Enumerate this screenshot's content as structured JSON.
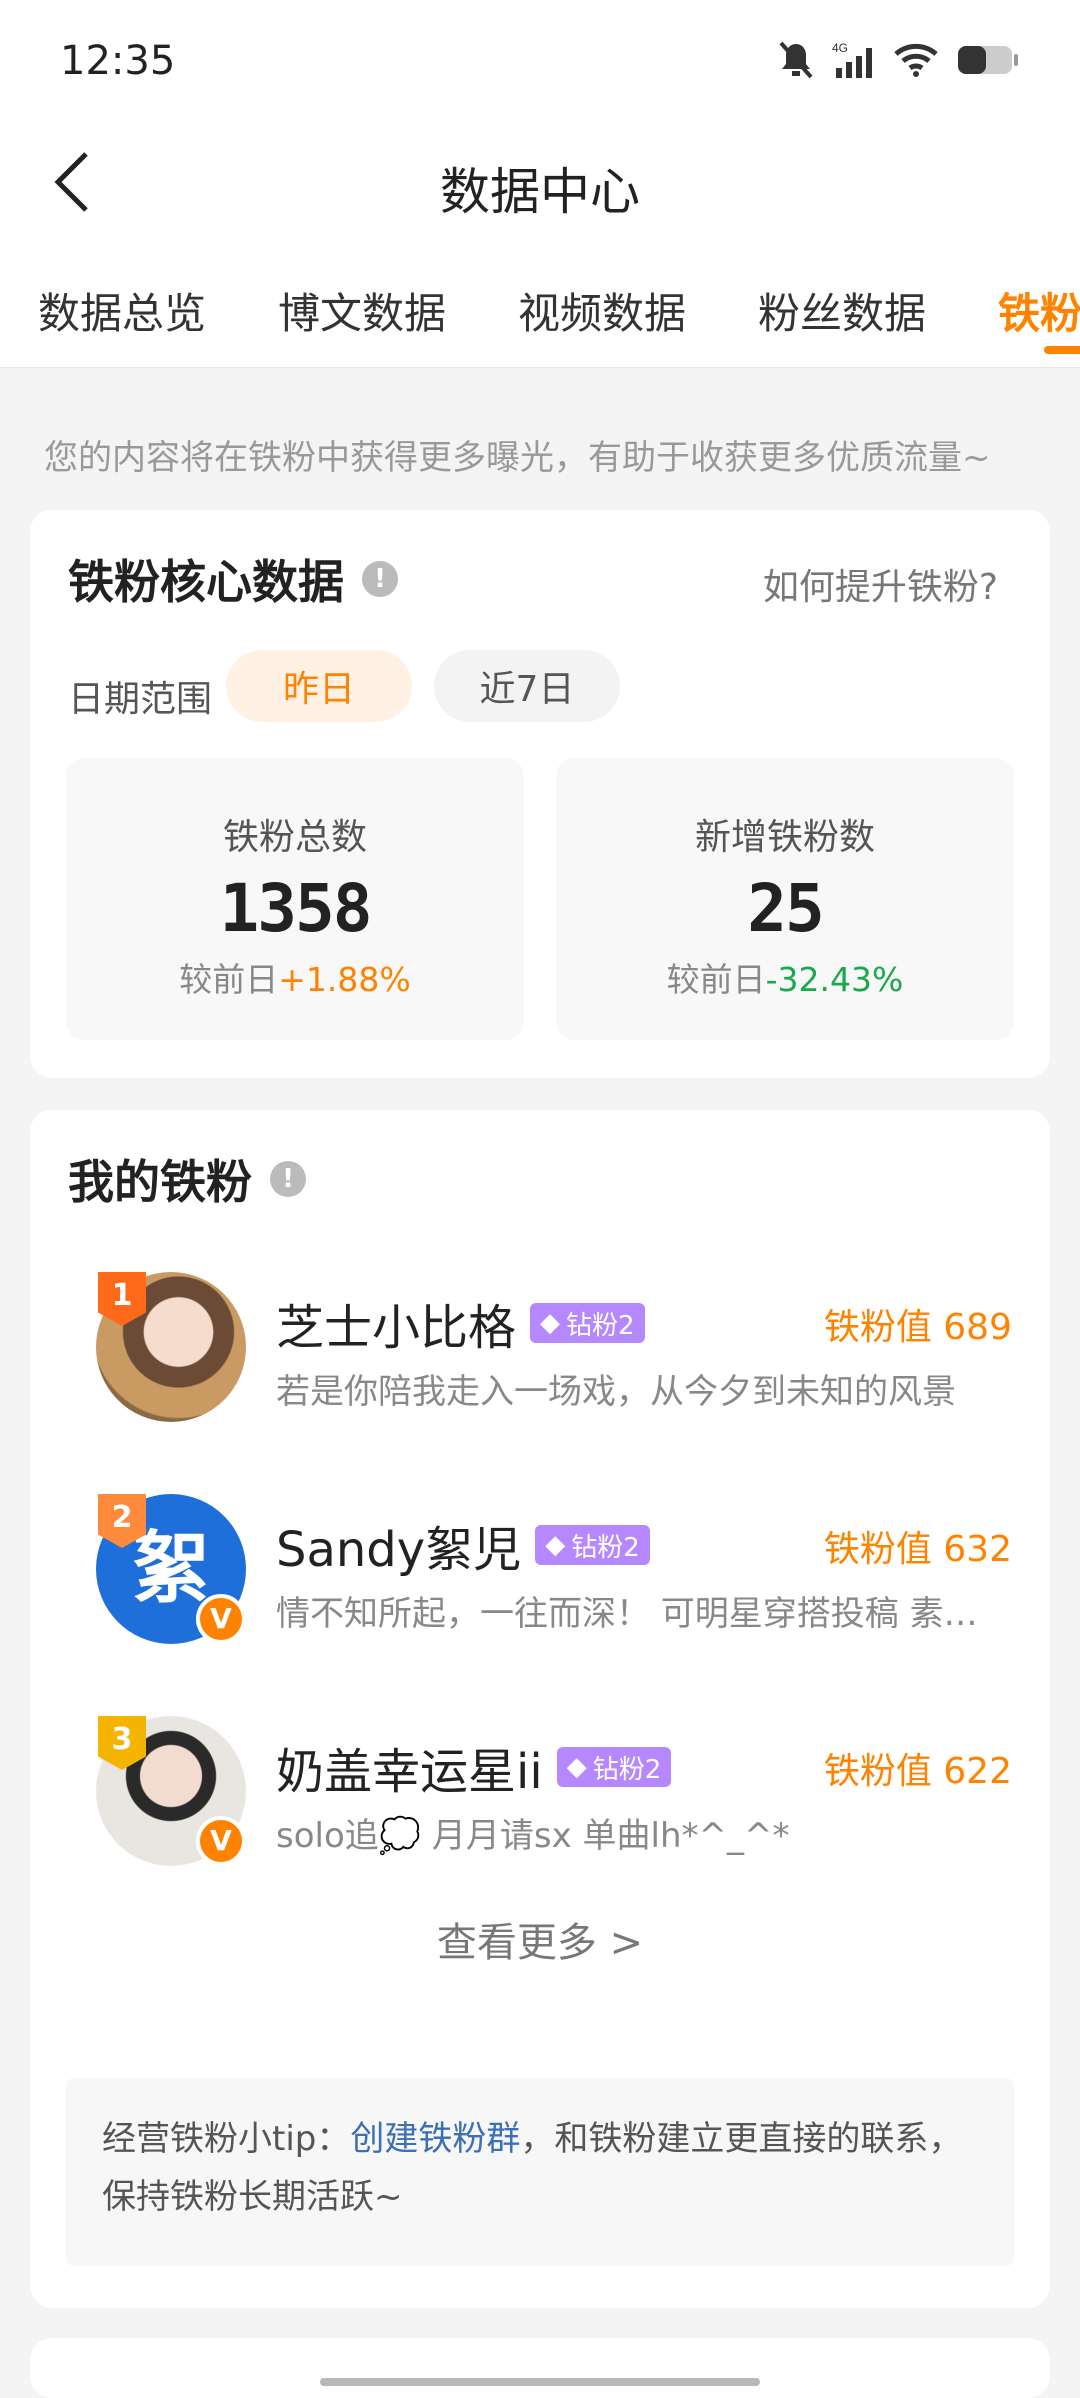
{
  "status": {
    "time": "12:35"
  },
  "header": {
    "title": "数据中心"
  },
  "tabs": [
    "数据总览",
    "博文数据",
    "视频数据",
    "粉丝数据",
    "铁粉"
  ],
  "tip_line": "您的内容将在铁粉中获得更多曝光，有助于收获更多优质流量~",
  "core": {
    "title": "铁粉核心数据",
    "help_link": "如何提升铁粉?",
    "date_label": "日期范围",
    "date_options": [
      "昨日",
      "近7日"
    ],
    "selected_date": "昨日",
    "stats": [
      {
        "label": "铁粉总数",
        "value": "1358",
        "compare_prefix": "较前日",
        "compare": "+1.88%"
      },
      {
        "label": "新增铁粉数",
        "value": "25",
        "compare_prefix": "较前日",
        "compare": "-32.43%"
      }
    ]
  },
  "my_fans": {
    "title": "我的铁粉",
    "items": [
      {
        "rank": "1",
        "name": "芝士小比格",
        "badge": "钻粉2",
        "score": "铁粉值 689",
        "desc": "若是你陪我走入一场戏，从今夕到未知的风景"
      },
      {
        "rank": "2",
        "name": "Sandy絮児",
        "badge": "钻粉2",
        "score": "铁粉值 632",
        "desc": "情不知所起，一往而深！ 可明星穿搭投稿 素…",
        "avatar_text": "絮"
      },
      {
        "rank": "3",
        "name": "奶盖幸运星ii",
        "badge": "钻粉2",
        "score": "铁粉值 622",
        "desc": "solo追💭 月月请sx 单曲lh*^_^*"
      }
    ],
    "more": "查看更多 >",
    "tip_prefix": "经营铁粉小tip：",
    "tip_link": "创建铁粉群",
    "tip_suffix": "，和铁粉建立更直接的联系，保持铁粉长期活跃~"
  },
  "colors": {
    "accent": "#ff8200",
    "up": "#ff8200",
    "down": "#1aa84a",
    "link": "#3b6fb6"
  }
}
